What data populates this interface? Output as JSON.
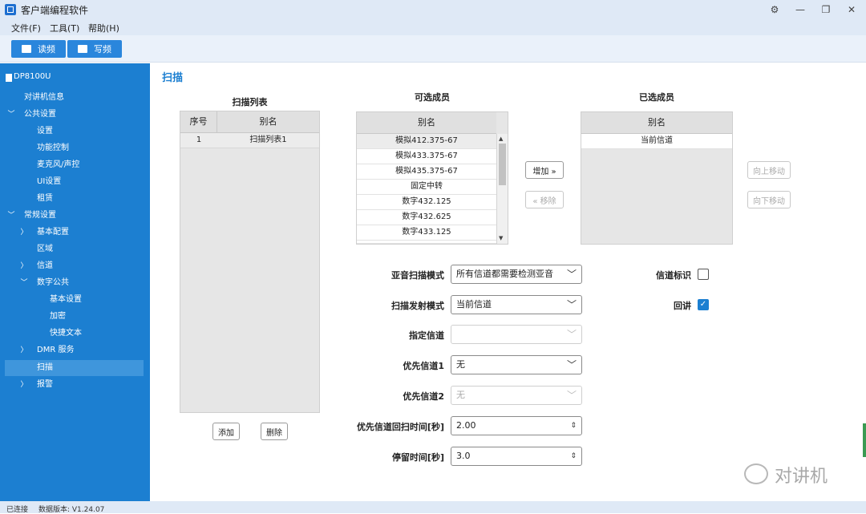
{
  "app": {
    "title": "客户端编程软件"
  },
  "menu": {
    "items": [
      "文件(F)",
      "工具(T)",
      "帮助(H)"
    ]
  },
  "toolbar": {
    "read_label": "读频",
    "write_label": "写频"
  },
  "device": {
    "name": "DP8100U"
  },
  "sidebar": {
    "items": [
      {
        "label": "对讲机信息"
      },
      {
        "label": "公共设置"
      },
      {
        "label": "设置"
      },
      {
        "label": "功能控制"
      },
      {
        "label": "麦克风/声控"
      },
      {
        "label": "UI设置"
      },
      {
        "label": "租赁"
      },
      {
        "label": "常规设置"
      },
      {
        "label": "基本配置"
      },
      {
        "label": "区域"
      },
      {
        "label": "信道"
      },
      {
        "label": "数字公共"
      },
      {
        "label": "基本设置"
      },
      {
        "label": "加密"
      },
      {
        "label": "快捷文本"
      },
      {
        "label": "DMR 服务"
      },
      {
        "label": "扫描"
      },
      {
        "label": "报警"
      }
    ]
  },
  "page": {
    "title": "扫描"
  },
  "scan_list": {
    "title": "扫描列表",
    "columns": [
      "序号",
      "别名"
    ],
    "rows": [
      {
        "no": "1",
        "name": "扫描列表1"
      }
    ],
    "add_label": "添加",
    "delete_label": "删除"
  },
  "available": {
    "title": "可选成员",
    "column": "别名",
    "rows": [
      "模拟412.375-67",
      "模拟433.375-67",
      "模拟435.375-67",
      "固定中转",
      "数字432.125",
      "数字432.625",
      "数字433.125"
    ]
  },
  "member_buttons": {
    "add": "增加 »",
    "remove": "« 移除"
  },
  "selected": {
    "title": "已选成员",
    "column": "别名",
    "rows": [
      "当前信道"
    ],
    "up_label": "向上移动",
    "down_label": "向下移动"
  },
  "form": {
    "subaudio_label": "亚音扫描模式",
    "subaudio_value": "所有信道都需要检测亚音",
    "tx_mode_label": "扫描发射模式",
    "tx_mode_value": "当前信道",
    "designated_label": "指定信道",
    "designated_value": "",
    "priority1_label": "优先信道1",
    "priority1_value": "无",
    "priority2_label": "优先信道2",
    "priority2_value": "无",
    "priority_time_label": "优先信道回扫时间[秒]",
    "priority_time_value": "2.00",
    "dwell_label": "停留时间[秒]",
    "dwell_value": "3.0",
    "channel_mark_label": "信道标识",
    "talkback_label": "回讲"
  },
  "status": {
    "connection": "已连接",
    "db_version": "数据版本: V1.24.07"
  },
  "watermark": {
    "text": "对讲机"
  }
}
